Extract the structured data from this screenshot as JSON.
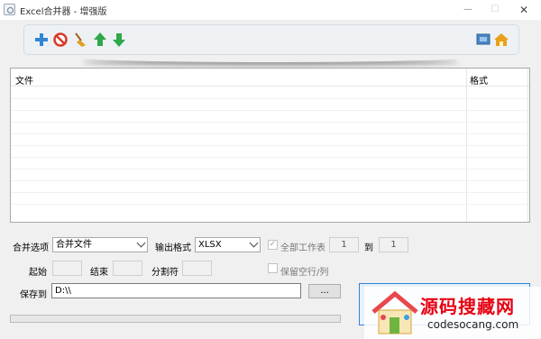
{
  "window": {
    "title": "Excel合并器 - 增强版",
    "min_glyph": "—",
    "max_glyph": "☐",
    "close_glyph": "✕"
  },
  "toolbar": {
    "buttons": [
      {
        "name": "add-file",
        "icon": "plus-icon",
        "color": "#2f86d6"
      },
      {
        "name": "remove-file",
        "icon": "no-entry-icon",
        "color": "#d83a2a"
      },
      {
        "name": "clear-list",
        "icon": "broom-icon",
        "color": "#e0a020"
      },
      {
        "name": "move-up",
        "icon": "arrow-up-icon",
        "color": "#2fa84a"
      },
      {
        "name": "move-down",
        "icon": "arrow-down-icon",
        "color": "#2fa84a"
      },
      {
        "name": "about",
        "icon": "flag-icon",
        "color": "#4a86c6"
      },
      {
        "name": "home",
        "icon": "home-icon",
        "color": "#e8a11a"
      }
    ]
  },
  "file_list": {
    "columns": [
      "文件",
      "格式"
    ],
    "rows": []
  },
  "options": {
    "merge_option_label": "合并选项",
    "merge_option_value": "合并文件",
    "output_format_label": "输出格式",
    "output_format_value": "XLSX",
    "all_sheets_label": "全部工作表",
    "all_sheets_checked": true,
    "sheet_from": "1",
    "sheet_to_label": "到",
    "sheet_to": "1",
    "start_label": "起始",
    "start_value": "",
    "end_label": "结束",
    "end_value": "",
    "separator_label": "分割符",
    "separator_value": "",
    "keep_empty_label": "保留空行/列",
    "keep_empty_checked": false,
    "save_to_label": "保存到",
    "save_to_value": "D:\\\\",
    "browse_label": "...",
    "progress": 0
  },
  "watermark": {
    "title": "源码搜藏网",
    "url": "codesocang.com"
  }
}
